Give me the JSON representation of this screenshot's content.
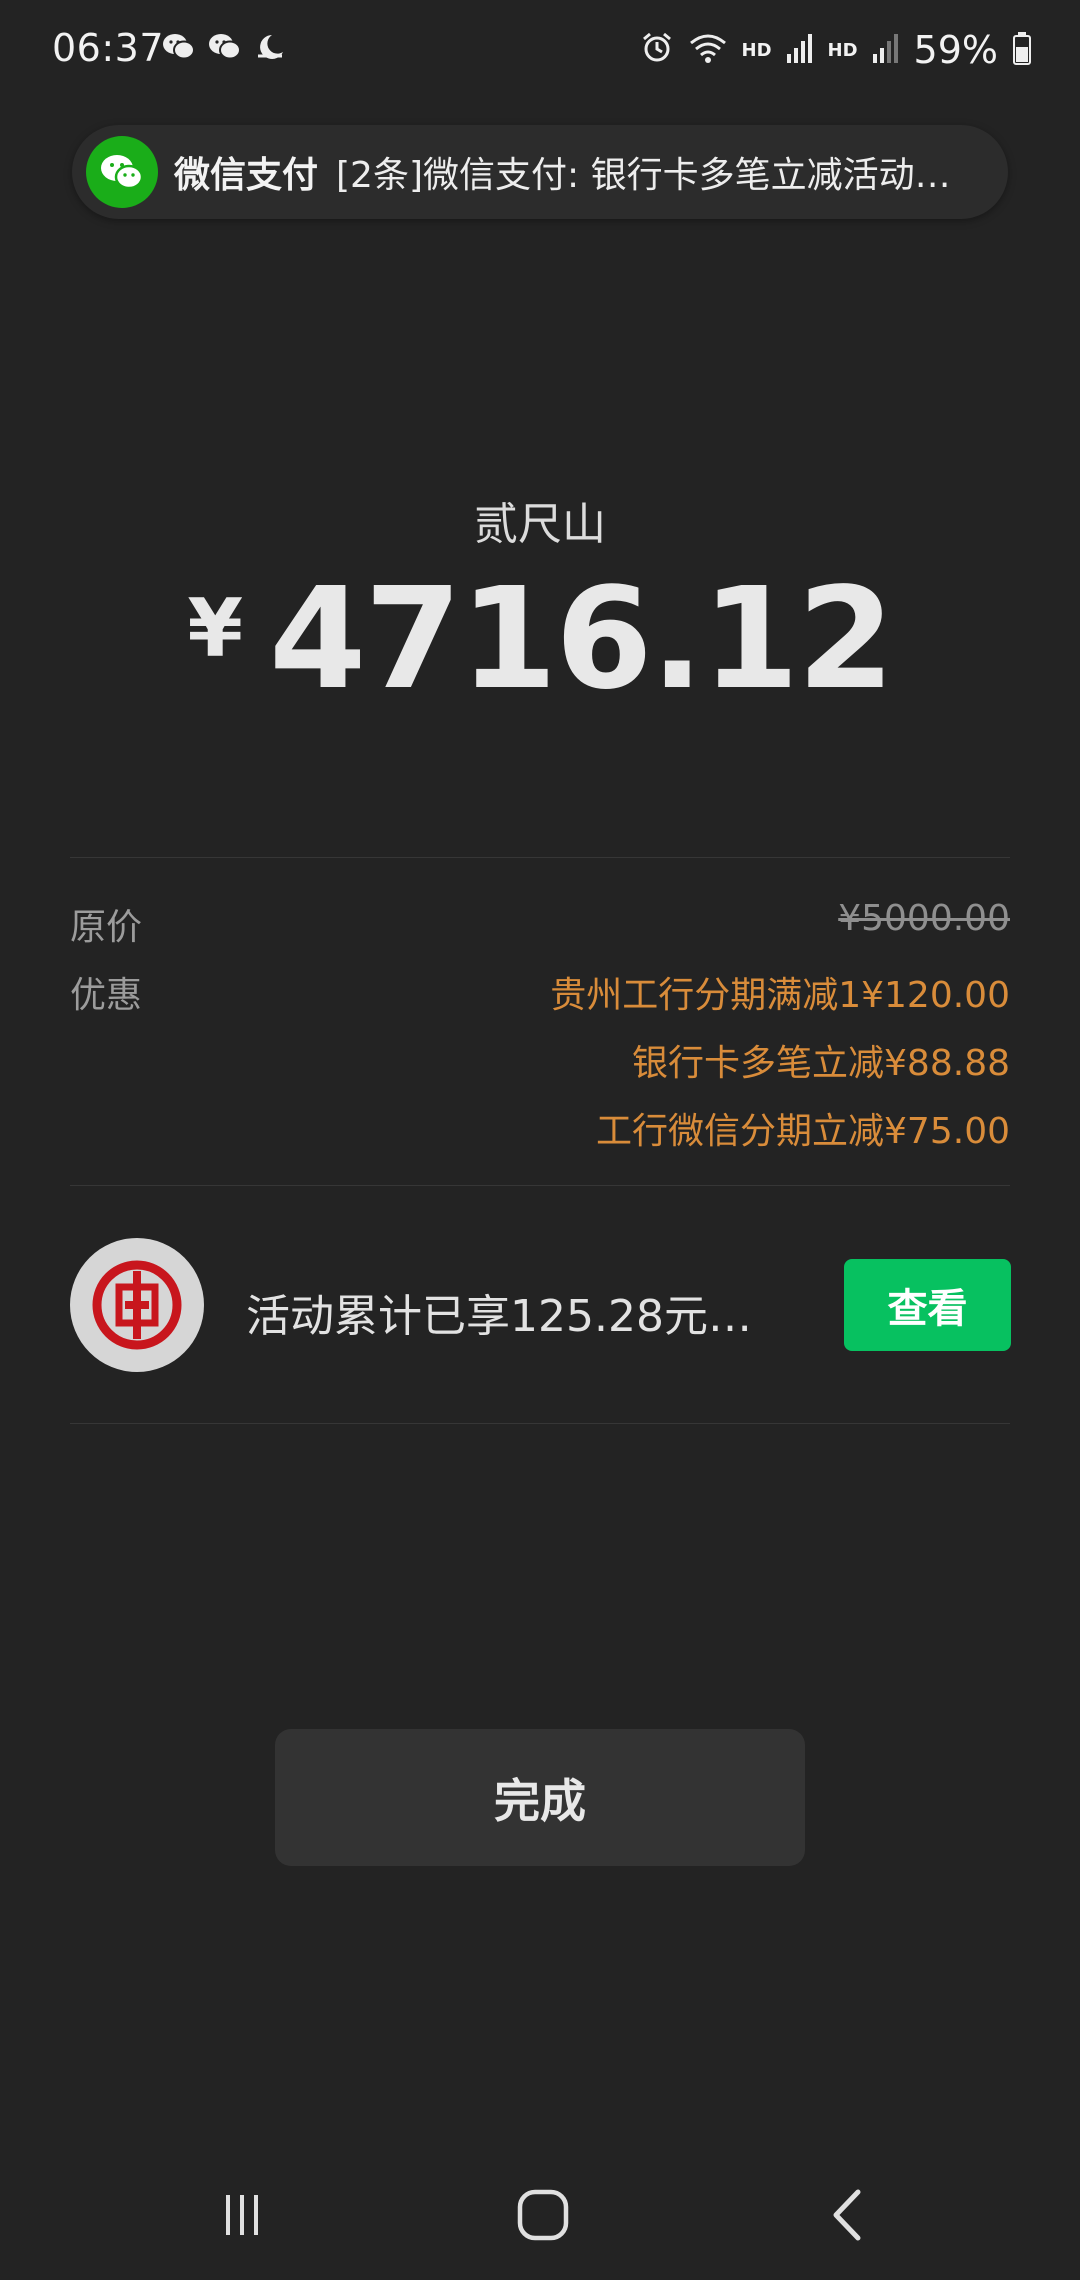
{
  "status_bar": {
    "time": "06:37",
    "left_icons": [
      "wechat-icon",
      "wechat-icon",
      "moon-icon"
    ],
    "right_icons": [
      "alarm-icon",
      "wifi-icon",
      "signal-icon",
      "signal-icon",
      "battery-icon"
    ],
    "hd1": "HD",
    "hd2": "HD",
    "battery_percent": "59%"
  },
  "notification": {
    "app_name": "微信支付",
    "message": "[2条]微信支付: 银行卡多笔立减活动…",
    "icon": "wechat-pay-icon"
  },
  "payment": {
    "payee": "贰尺山",
    "currency": "¥",
    "amount": "4716.12"
  },
  "price_details": {
    "original_label": "原价",
    "original_value": "¥5000.00",
    "discount_label": "优惠",
    "discounts": [
      "贵州工行分期满减1¥120.00",
      "银行卡多笔立减¥88.88",
      "工行微信分期立减¥75.00"
    ]
  },
  "activity": {
    "logo": "icbc-logo",
    "text": "活动累计已享125.28元…",
    "button_label": "查看"
  },
  "done_button": "完成",
  "nav": {
    "recents_icon": "recents-icon",
    "home_icon": "home-icon",
    "back_icon": "back-icon"
  },
  "colors": {
    "background": "#232323",
    "discount": "#d98c3a",
    "accent_green": "#07c160",
    "wechat_green": "#1aad19"
  }
}
